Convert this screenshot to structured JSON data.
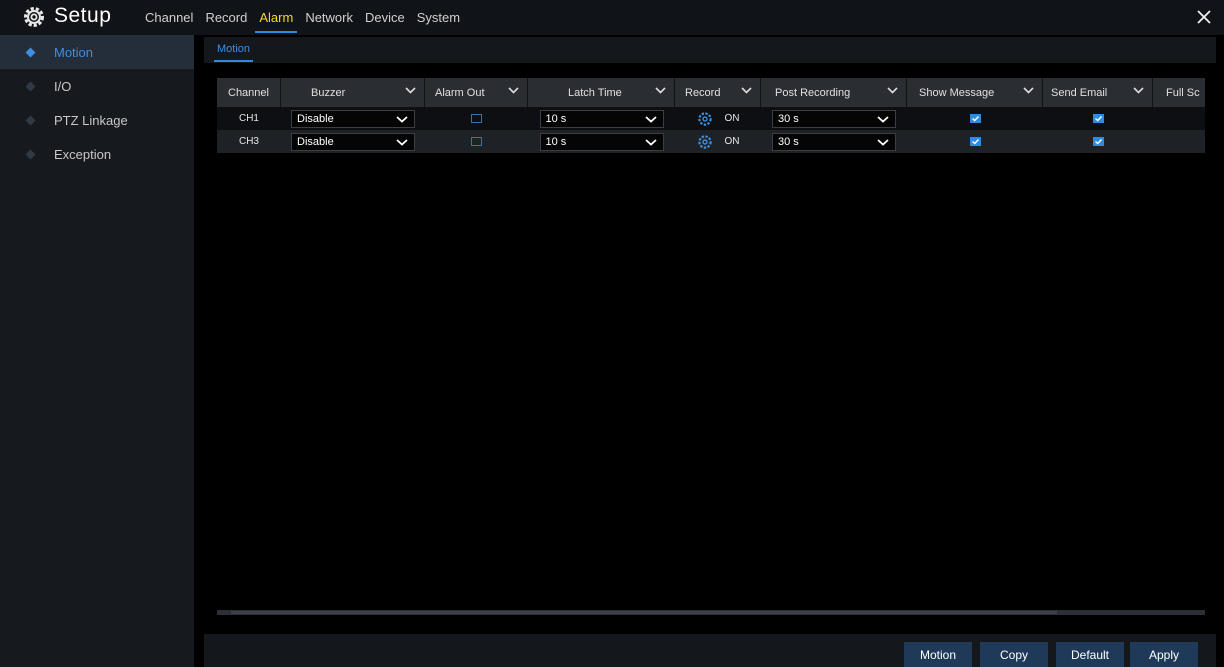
{
  "header": {
    "title": "Setup",
    "menu": [
      "Channel",
      "Record",
      "Alarm",
      "Network",
      "Device",
      "System"
    ],
    "active_menu": "Alarm"
  },
  "sidebar": {
    "items": [
      {
        "label": "Motion",
        "active": true
      },
      {
        "label": "I/O",
        "active": false
      },
      {
        "label": "PTZ Linkage",
        "active": false
      },
      {
        "label": "Exception",
        "active": false
      }
    ]
  },
  "subtab": {
    "label": "Motion"
  },
  "table": {
    "columns": [
      "Channel",
      "Buzzer",
      "Alarm Out",
      "Latch Time",
      "Record",
      "Post Recording",
      "Show Message",
      "Send Email",
      "Full Sc"
    ],
    "rows": [
      {
        "channel": "CH1",
        "buzzer": "Disable",
        "alarm_out": false,
        "latch_time": "10 s",
        "record": "ON",
        "post_recording": "30 s",
        "show_message": true,
        "send_email": true
      },
      {
        "channel": "CH3",
        "buzzer": "Disable",
        "alarm_out": false,
        "latch_time": "10 s",
        "record": "ON",
        "post_recording": "30 s",
        "show_message": true,
        "send_email": true
      }
    ]
  },
  "buttons": {
    "motion": "Motion",
    "copy": "Copy",
    "default": "Default",
    "apply": "Apply"
  },
  "colors": {
    "accent": "#2f8be0",
    "active_menu": "#f3d92e",
    "button": "#1e3a58"
  }
}
